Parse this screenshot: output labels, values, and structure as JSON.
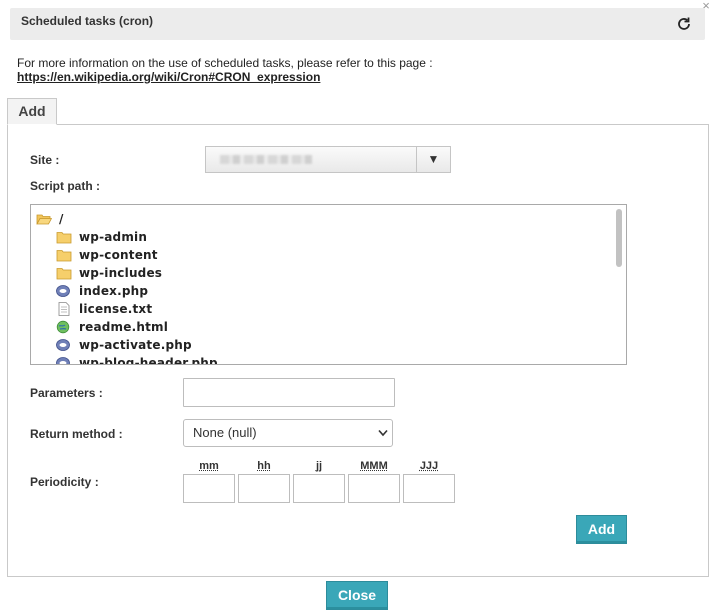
{
  "dialog": {
    "title": "Scheduled tasks (cron)",
    "close_symbol": "×",
    "info_text": "For more information on the use of scheduled tasks, please refer to this page :",
    "info_link": "https://en.wikipedia.org/wiki/Cron#CRON_expression"
  },
  "tabs": [
    {
      "label": "Add"
    }
  ],
  "form": {
    "site_label": "Site :",
    "site_arrow": "▼",
    "script_path_label": "Script path :",
    "tree": [
      {
        "name": "/",
        "icon": "folder-open-icon"
      },
      {
        "name": "wp-admin",
        "icon": "folder-icon"
      },
      {
        "name": "wp-content",
        "icon": "folder-icon"
      },
      {
        "name": "wp-includes",
        "icon": "folder-icon"
      },
      {
        "name": "index.php",
        "icon": "php-file-icon"
      },
      {
        "name": "license.txt",
        "icon": "text-file-icon"
      },
      {
        "name": "readme.html",
        "icon": "html-file-icon"
      },
      {
        "name": "wp-activate.php",
        "icon": "php-file-icon"
      },
      {
        "name": "wp-blog-header.php",
        "icon": "php-file-icon"
      }
    ],
    "parameters_label": "Parameters :",
    "parameters_value": "",
    "return_method_label": "Return method :",
    "return_method_value": "None (null)",
    "periodicity_label": "Periodicity :",
    "periodicity_fields": [
      "mm",
      "hh",
      "jj",
      "MMM",
      "JJJ"
    ],
    "add_button": "Add"
  },
  "footer": {
    "close_button": "Close"
  },
  "colors": {
    "button": "#3aa7b8",
    "title_bar": "#ececec",
    "folder": "#f3c55a"
  }
}
